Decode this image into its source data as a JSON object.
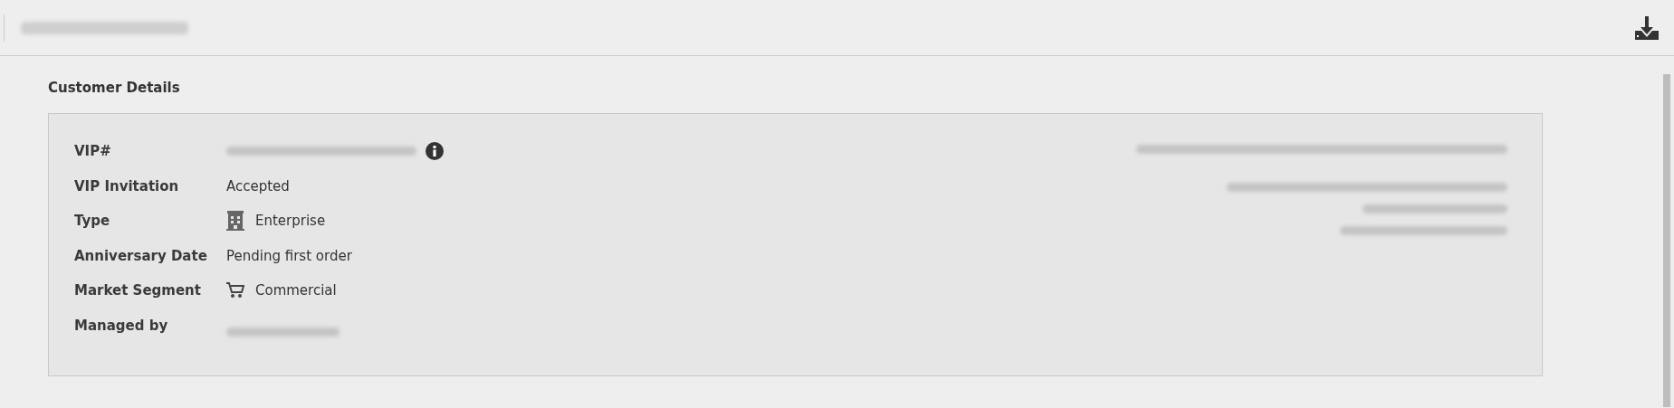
{
  "section_title": "Customer Details",
  "details": [
    {
      "label": "VIP#",
      "kind": "redacted_info"
    },
    {
      "label": "VIP Invitation",
      "kind": "text",
      "value": "Accepted"
    },
    {
      "label": "Type",
      "kind": "building",
      "value": "Enterprise"
    },
    {
      "label": "Anniversary Date",
      "kind": "text",
      "value": "Pending first order"
    },
    {
      "label": "Market Segment",
      "kind": "cart",
      "value": "Commercial"
    },
    {
      "label": "Managed by",
      "kind": "redacted"
    }
  ]
}
